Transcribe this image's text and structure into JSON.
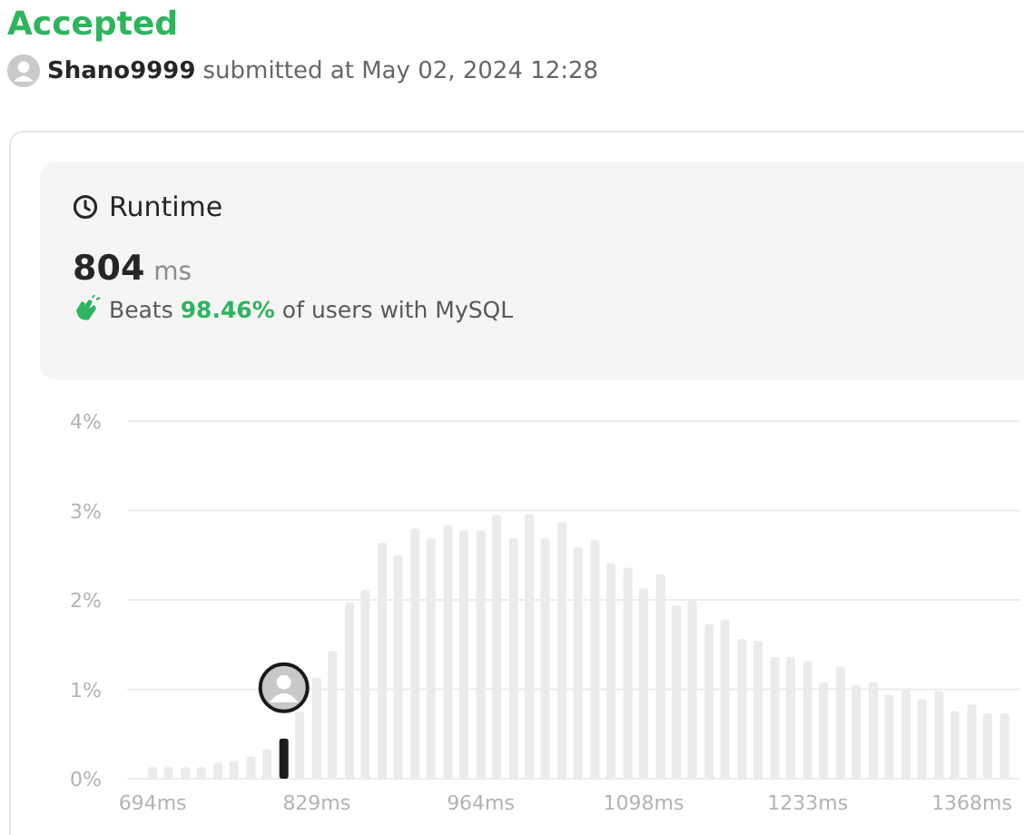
{
  "status": "Accepted",
  "submission": {
    "user": "Shano9999",
    "text": "submitted at May 02, 2024 12:28"
  },
  "runtime": {
    "title": "Runtime",
    "value": "804",
    "unit": "ms",
    "beats_label": "Beats",
    "beats_value": "98.46%",
    "beats_rest": "of users with MySQL"
  },
  "chart_data": {
    "type": "bar",
    "stacked": true,
    "grid": true,
    "x": [
      694,
      707,
      721,
      734,
      748,
      761,
      775,
      788,
      802,
      815,
      829,
      842,
      856,
      869,
      883,
      896,
      910,
      923,
      937,
      950,
      964,
      977,
      991,
      1004,
      1017,
      1031,
      1044,
      1058,
      1071,
      1085,
      1098,
      1112,
      1125,
      1138,
      1152,
      1165,
      1179,
      1192,
      1206,
      1219,
      1233,
      1246,
      1260,
      1273,
      1287,
      1300,
      1314,
      1327,
      1341,
      1354,
      1368,
      1381,
      1395
    ],
    "series": [
      {
        "color": "#ebebeb",
        "values": [
          0.13,
          0.13,
          0.13,
          0.13,
          0.18,
          0.2,
          0.25,
          0.33,
          null,
          0.75,
          1.13,
          1.43,
          1.97,
          2.11,
          2.64,
          2.5,
          2.8,
          2.69,
          2.83,
          2.78,
          2.78,
          2.95,
          2.69,
          2.96,
          2.69,
          2.87,
          2.59,
          2.67,
          2.41,
          2.36,
          2.13,
          2.29,
          1.94,
          1.99,
          1.73,
          1.78,
          1.56,
          1.54,
          1.36,
          1.36,
          1.31,
          1.08,
          1.26,
          1.05,
          1.08,
          0.94,
          1.0,
          0.89,
          0.98,
          0.76,
          0.83,
          0.73,
          0.73
        ]
      },
      {
        "color": "#1a1a1a",
        "values": [
          null,
          null,
          null,
          null,
          null,
          null,
          null,
          null,
          0.45,
          null,
          null,
          null,
          null,
          null,
          null,
          null,
          null,
          null,
          null,
          null,
          null,
          null,
          null,
          null,
          null,
          null,
          null,
          null,
          null,
          null,
          null,
          null,
          null,
          null,
          null,
          null,
          null,
          null,
          null,
          null,
          null,
          null,
          null,
          null,
          null,
          null,
          null,
          null,
          null,
          null,
          null,
          null,
          null
        ]
      }
    ],
    "xlim": [
      673,
      1408
    ],
    "ylim": [
      0,
      4
    ],
    "yticks": [
      {
        "value": 0,
        "label": "0%"
      },
      {
        "value": 1,
        "label": "1%"
      },
      {
        "value": 2,
        "label": "2%"
      },
      {
        "value": 3,
        "label": "3%"
      },
      {
        "value": 4,
        "label": "4%"
      }
    ],
    "xticks": [
      {
        "value": 694,
        "label": "694ms"
      },
      {
        "value": 829,
        "label": "829ms"
      },
      {
        "value": 964,
        "label": "964ms"
      },
      {
        "value": 1098,
        "label": "1098ms"
      },
      {
        "value": 1233,
        "label": "1233ms"
      },
      {
        "value": 1368,
        "label": "1368ms"
      }
    ]
  }
}
